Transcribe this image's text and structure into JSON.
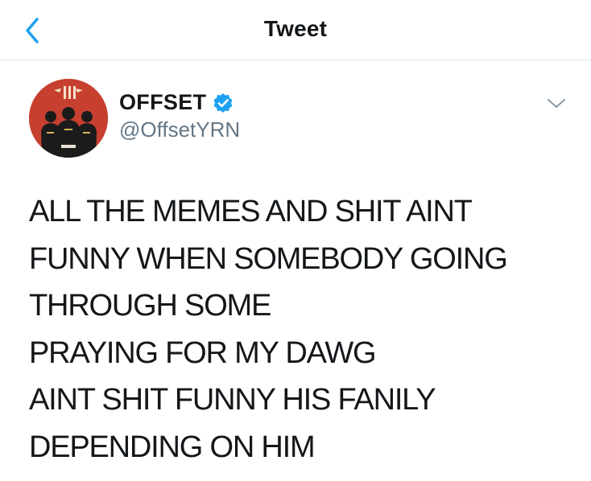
{
  "nav": {
    "title": "Tweet",
    "back_icon": "chevron-left-icon"
  },
  "author": {
    "display_name": "OFFSET",
    "handle": "@OffsetYRN",
    "verified": true,
    "verified_icon": "verified-badge-icon"
  },
  "tweet": {
    "lines": [
      "ALL THE MEMES AND SHIT AINT",
      "FUNNY WHEN SOMEBODY GOING",
      "THROUGH SOME",
      "PRAYING FOR MY DAWG",
      "AINT SHIT FUNNY HIS FANILY",
      "DEPENDING ON HIM"
    ]
  },
  "colors": {
    "accent": "#1da1f2",
    "text": "#14171a",
    "secondary_text": "#657786",
    "divider": "#e1e8ed",
    "avatar_bg": "#c7402f"
  }
}
